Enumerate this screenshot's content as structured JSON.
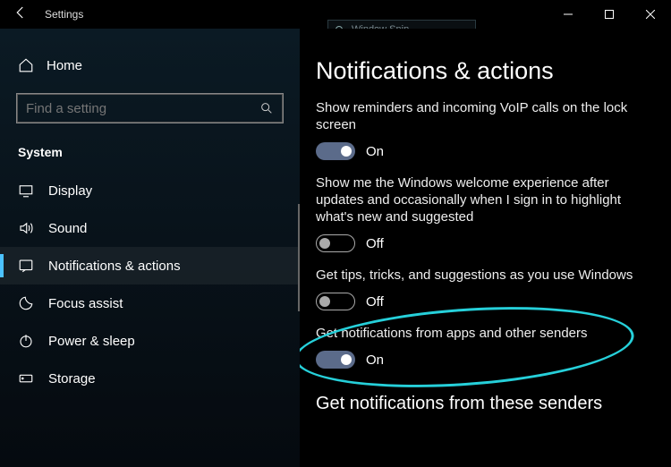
{
  "titlebar": {
    "title": "Settings"
  },
  "sidebar": {
    "home": "Home",
    "search_placeholder": "Find a setting",
    "section": "System",
    "items": [
      {
        "label": "Display"
      },
      {
        "label": "Sound"
      },
      {
        "label": "Notifications & actions"
      },
      {
        "label": "Focus assist"
      },
      {
        "label": "Power & sleep"
      },
      {
        "label": "Storage"
      }
    ]
  },
  "page": {
    "title": "Notifications & actions",
    "settings": [
      {
        "desc": "Show reminders and incoming VoIP calls on the lock screen",
        "state": "On",
        "on": true
      },
      {
        "desc": "Show me the Windows welcome experience after updates and occasionally when I sign in to highlight what's new and suggested",
        "state": "Off",
        "on": false
      },
      {
        "desc": "Get tips, tricks, and suggestions as you use Windows",
        "state": "Off",
        "on": false
      },
      {
        "desc": "Get notifications from apps and other senders",
        "state": "On",
        "on": true
      }
    ],
    "subheading": "Get notifications from these senders"
  },
  "snip": {
    "label": "Window Snip"
  }
}
